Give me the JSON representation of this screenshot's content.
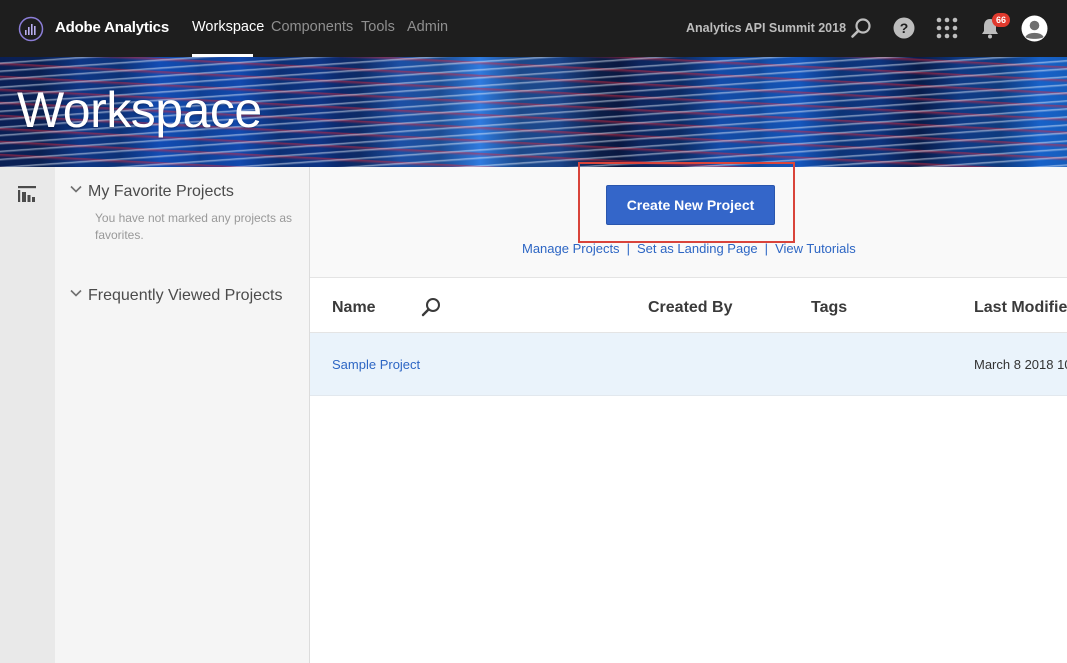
{
  "topnav": {
    "brand": "Adobe Analytics",
    "items": [
      {
        "label": "Workspace",
        "active": true
      },
      {
        "label": "Components",
        "active": false
      },
      {
        "label": "Tools",
        "active": false
      },
      {
        "label": "Admin",
        "active": false
      }
    ],
    "company": "Analytics API Summit 2018",
    "notification_count": "66",
    "icons": [
      "search-icon",
      "help-icon",
      "apps-grid-icon",
      "bell-icon",
      "user-avatar-icon"
    ]
  },
  "banner": {
    "title": "Workspace"
  },
  "left_panel": {
    "favorites": {
      "title": "My Favorite Projects",
      "empty_text": "You have not marked any projects as favorites."
    },
    "frequent": {
      "title": "Frequently Viewed Projects"
    }
  },
  "main": {
    "create_button": "Create New Project",
    "links": [
      "Manage Projects",
      "Set as Landing Page",
      "View Tutorials"
    ],
    "separator": "|",
    "table": {
      "columns": [
        "Name",
        "Created By",
        "Tags",
        "Last Modified"
      ],
      "rows": [
        {
          "name": "Sample Project",
          "created_by": "",
          "tags": "",
          "last_modified": "March 8 2018 10"
        }
      ]
    }
  },
  "colors": {
    "nav_bg": "#1e1e1e",
    "primary_button": "#3466c9",
    "link": "#2d66c4",
    "highlight_box": "#d9443b",
    "selected_row": "#eaf3fb",
    "badge": "#e03a2e"
  }
}
